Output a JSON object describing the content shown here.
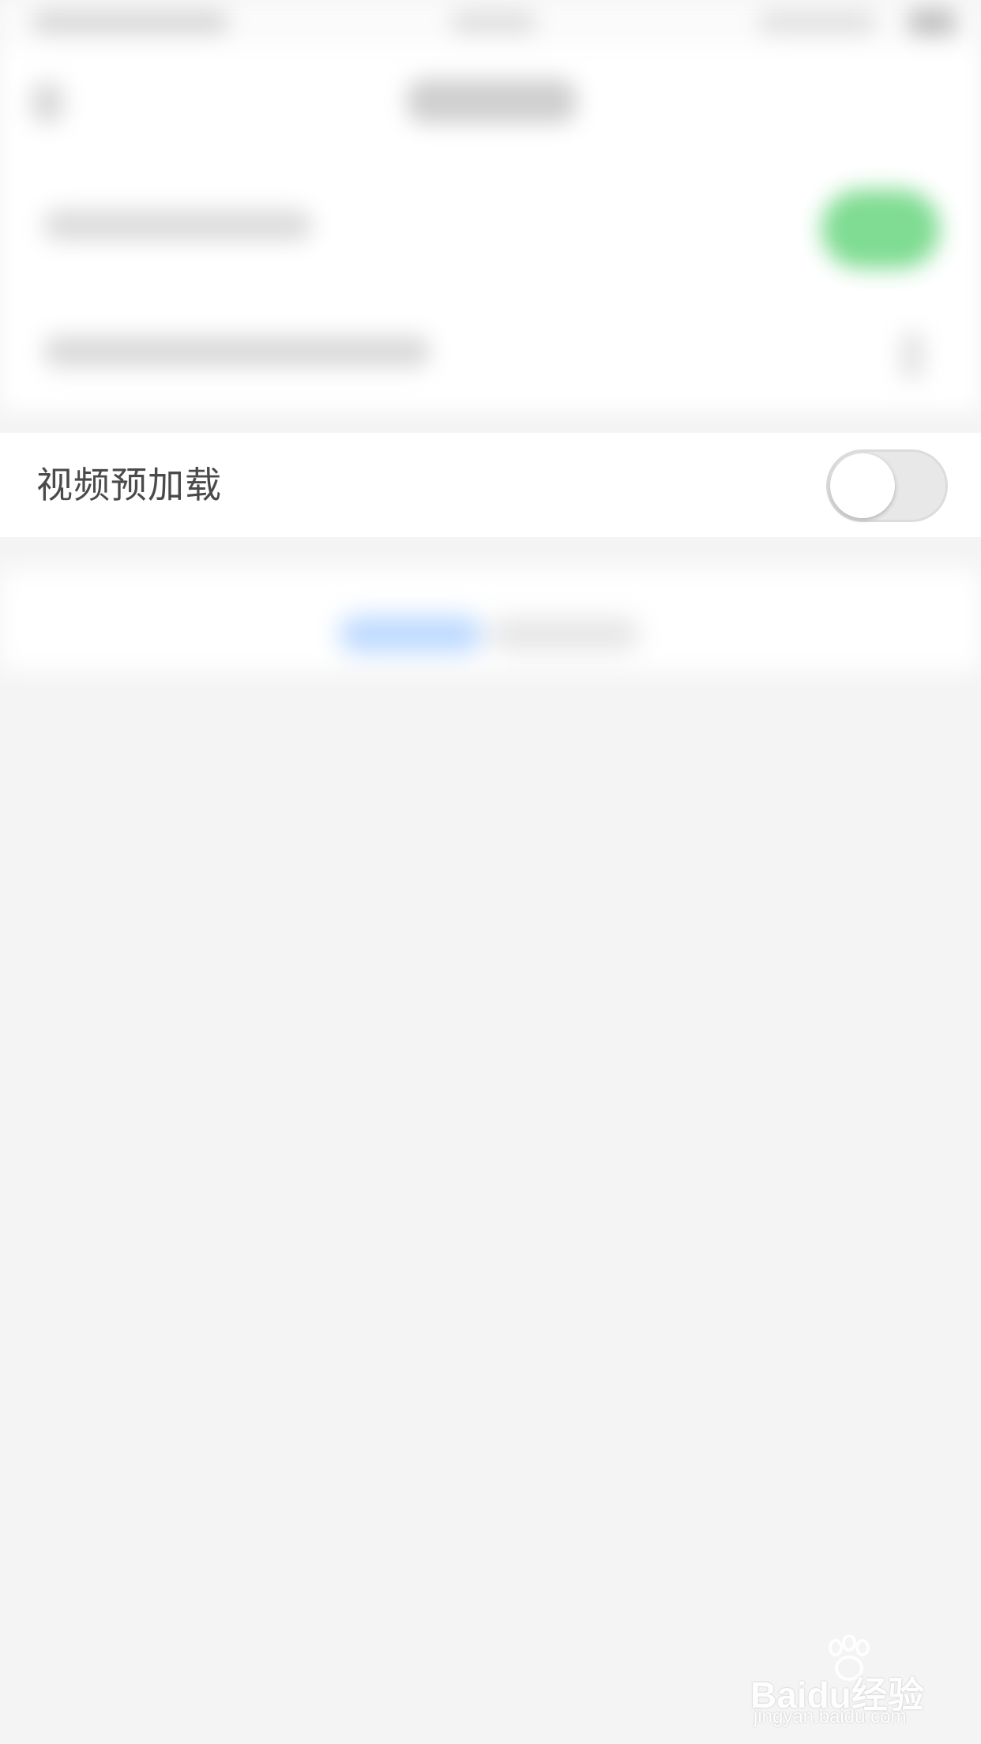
{
  "settings": {
    "video_preload": {
      "label": "视频预加载",
      "enabled": false
    }
  },
  "colors": {
    "toggle_on_color": "#7fdc92",
    "toggle_off_color": "#e8e8e8",
    "link_color": "#bcd9ff",
    "page_background": "#f4f4f4"
  },
  "icons": {
    "back": "back-arrow-icon",
    "chevron": "chevron-right-icon",
    "watermark_logo": "baidu-paw-icon"
  },
  "watermark": {
    "brand": "Baidu经验",
    "url": "jingyan.baidu.com"
  }
}
